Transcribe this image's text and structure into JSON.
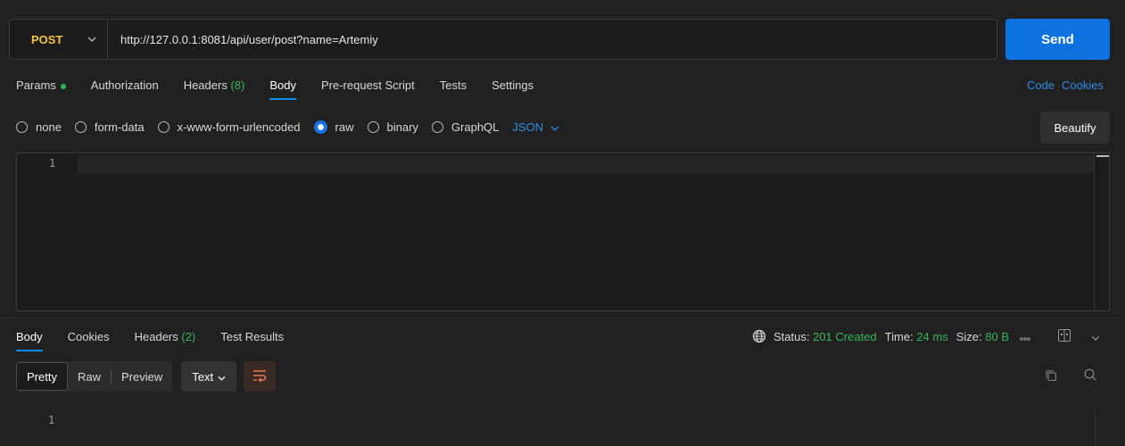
{
  "request": {
    "method": "POST",
    "url": "http://127.0.0.1:8081/api/user/post?name=Artemiy",
    "send_label": "Send"
  },
  "request_tabs": [
    {
      "label": "Params"
    },
    {
      "label": "Authorization"
    },
    {
      "label": "Headers",
      "count": "(8)"
    },
    {
      "label": "Body"
    },
    {
      "label": "Pre-request Script"
    },
    {
      "label": "Tests"
    },
    {
      "label": "Settings"
    }
  ],
  "links": {
    "code": "Code",
    "cookies": "Cookies"
  },
  "body_types": [
    "none",
    "form-data",
    "x-www-form-urlencoded",
    "raw",
    "binary",
    "GraphQL"
  ],
  "raw_format": "JSON",
  "beautify_label": "Beautify",
  "editor": {
    "line": "1"
  },
  "response_tabs": [
    {
      "label": "Body"
    },
    {
      "label": "Cookies"
    },
    {
      "label": "Headers",
      "count": "(2)"
    },
    {
      "label": "Test Results"
    }
  ],
  "status": {
    "status_label": "Status:",
    "status_value": "201 Created",
    "time_label": "Time:",
    "time_value": "24 ms",
    "size_label": "Size:",
    "size_value": "80 B"
  },
  "view_modes": [
    "Pretty",
    "Raw",
    "Preview"
  ],
  "text_format": "Text",
  "response": {
    "line": "1"
  },
  "colors": {
    "method": "#f5c242",
    "send": "#0d72e0",
    "accent": "#2d8ce6",
    "success": "#35b55a"
  }
}
